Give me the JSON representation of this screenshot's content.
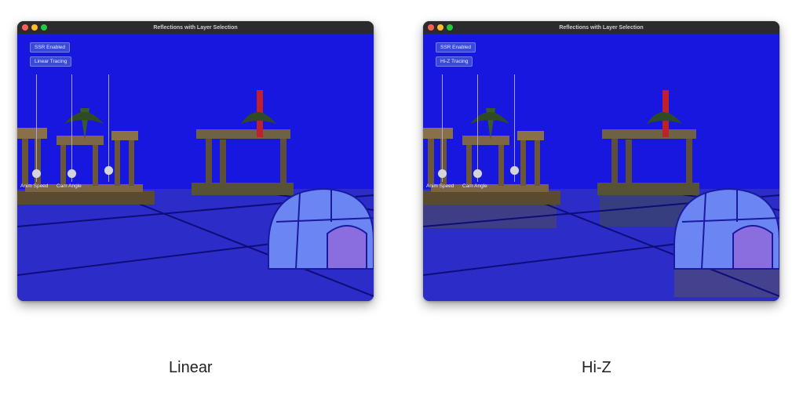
{
  "windows": [
    {
      "title": "Reflections with Layer Selection",
      "ssr_button": "SSR Enabled",
      "tracing_button": "Linear Tracing",
      "slider_labels": [
        "Anim Speed",
        "Cam Angle"
      ],
      "caption": "Linear"
    },
    {
      "title": "Reflections with Layer Selection",
      "ssr_button": "SSR Enabled",
      "tracing_button": "Hi-Z Tracing",
      "slider_labels": [
        "Anim Speed",
        "Cam Angle"
      ],
      "caption": "Hi-Z"
    }
  ],
  "colors": {
    "sky": "#1717e0",
    "floor": "#2e2ec8",
    "grid_line": "#0e0e7a",
    "temple_stone": "#6e5a3c",
    "igloo": "#6c8cff"
  }
}
